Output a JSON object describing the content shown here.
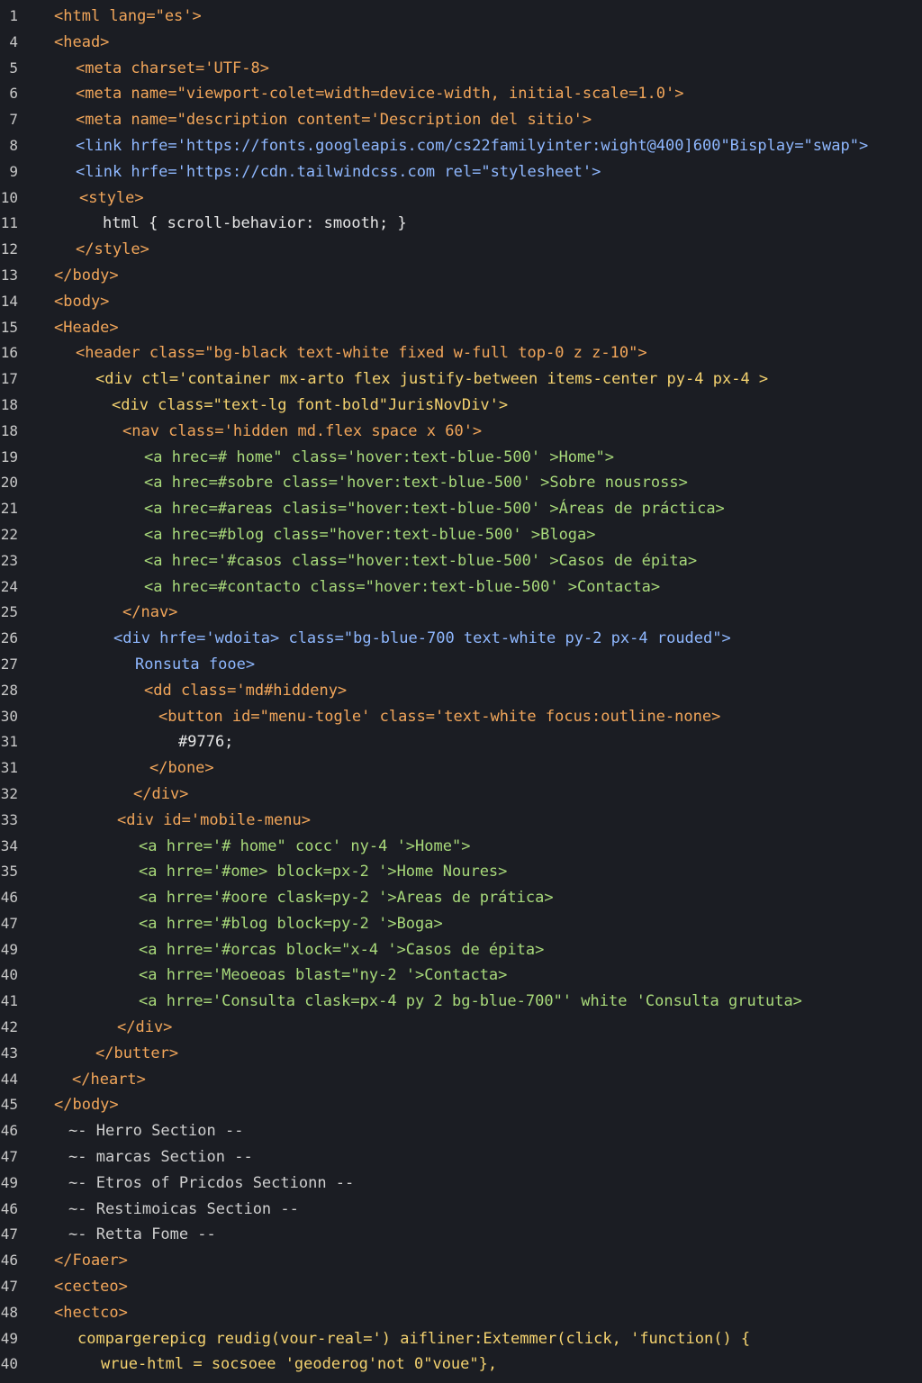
{
  "editor": {
    "lines": [
      {
        "number": "1",
        "indent": 0,
        "text": "<html lang=\"es'>",
        "color": "#f2a65a"
      },
      {
        "number": "4",
        "indent": 0,
        "text": "<head>",
        "color": "#f2a65a"
      },
      {
        "number": "5",
        "indent": 24,
        "text": "<meta charset='UTF-8>",
        "color": "#f2a65a"
      },
      {
        "number": "6",
        "indent": 24,
        "text": "<meta name=\"viewport-colet=width=device-width, initial-scale=1.0'>",
        "color": "#f2a65a"
      },
      {
        "number": "7",
        "indent": 24,
        "text": "<meta name=\"description content='Description del sitio'>",
        "color": "#f2a65a"
      },
      {
        "number": "8",
        "indent": 24,
        "text": "<link hrfe='https://fonts.googleapis.com/cs22familyinter:wight@400]600\"Bisplay=\"swap\">",
        "color": "#8fb8ff"
      },
      {
        "number": "9",
        "indent": 24,
        "text": "<link hrfe='https://cdn.tailwindcss.com rel=\"stylesheet'>",
        "color": "#8fb8ff"
      },
      {
        "number": "10",
        "indent": 28,
        "text": "<style>",
        "color": "#f2a65a"
      },
      {
        "number": "11",
        "indent": 54,
        "text": "html { scroll-behavior: smooth; }",
        "color": "#e6e6e6"
      },
      {
        "number": "12",
        "indent": 24,
        "text": "</style>",
        "color": "#f2a65a"
      },
      {
        "number": "13",
        "indent": 0,
        "text": "</body>",
        "color": "#f2a65a"
      },
      {
        "number": "14",
        "indent": 0,
        "text": "<body>",
        "color": "#f2a65a"
      },
      {
        "number": "15",
        "indent": 0,
        "text": "<Heade>",
        "color": "#f2a65a"
      },
      {
        "number": "16",
        "indent": 24,
        "text": "<header class=\"bg-black text-white fixed w-full top-0 z z-10\">",
        "color": "#f2a65a"
      },
      {
        "number": "17",
        "indent": 46,
        "text": "<div ctl='container mx-arto flex justify-between items-center py-4 px-4 >",
        "color": "#f4d26f"
      },
      {
        "number": "18",
        "indent": 64,
        "text": "<div class=\"text-lg font-bold\"JurisNovDiv'>",
        "color": "#f4d26f"
      },
      {
        "number": "18",
        "indent": 76,
        "text": "<nav class='hidden md.flex space x 60'>",
        "color": "#f2a65a"
      },
      {
        "number": "19",
        "indent": 100,
        "text": "<a hrec=# home\" class='hover:text-blue-500' >Home\">",
        "color": "#a8d97a"
      },
      {
        "number": "20",
        "indent": 100,
        "text": "<a hrec=#sobre class='hover:text-blue-500' >Sobre nousross>",
        "color": "#a8d97a"
      },
      {
        "number": "21",
        "indent": 100,
        "text": "<a hrec=#areas clasis=\"hover:text-blue-500' >Áreas de práctica>",
        "color": "#a8d97a"
      },
      {
        "number": "22",
        "indent": 100,
        "text": "<a hrec=#blog class=\"hover:text-blue-500' >Bloga>",
        "color": "#a8d97a"
      },
      {
        "number": "23",
        "indent": 100,
        "text": "<a hrec='#casos class=\"hover:text-blue-500' >Casos de épita>",
        "color": "#a8d97a"
      },
      {
        "number": "24",
        "indent": 100,
        "text": "<a hrec=#contacto class=\"hover:text-blue-500' >Contacta>",
        "color": "#a8d97a"
      },
      {
        "number": "25",
        "indent": 76,
        "text": "</nav>",
        "color": "#f2a65a"
      },
      {
        "number": "26",
        "indent": 66,
        "text": "<div hrfe='wdoita> class=\"bg-blue-700 text-white py-2 px-4 rouded\">",
        "color": "#8fb8ff"
      },
      {
        "number": "27",
        "indent": 90,
        "text": "Ronsuta fooe>",
        "color": "#8fb8ff"
      },
      {
        "number": "28",
        "indent": 100,
        "text": "<dd class='md#hiddeny>",
        "color": "#f2a65a"
      },
      {
        "number": "30",
        "indent": 116,
        "text": "<button id=\"menu-togle' class='text-white focus:outline-none>",
        "color": "#f2a65a"
      },
      {
        "number": "31",
        "indent": 138,
        "text": "#9776;",
        "color": "#e6e6e6"
      },
      {
        "number": "31",
        "indent": 106,
        "text": "</bone>",
        "color": "#f2a65a"
      },
      {
        "number": "32",
        "indent": 88,
        "text": "</div>",
        "color": "#f2a65a"
      },
      {
        "number": "33",
        "indent": 70,
        "text": "<div id='mobile-menu>",
        "color": "#f2a65a"
      },
      {
        "number": "34",
        "indent": 94,
        "text": "<a hrre='# home\" cocc' ny-4 '>Home\">",
        "color": "#a8d97a"
      },
      {
        "number": "35",
        "indent": 94,
        "text": "<a hrre='#ome> block=px-2 '>Home Noures>",
        "color": "#a8d97a"
      },
      {
        "number": "46",
        "indent": 94,
        "text": "<a hrre='#oore clask=py-2 '>Areas de prática>",
        "color": "#a8d97a"
      },
      {
        "number": "47",
        "indent": 94,
        "text": "<a hrre='#blog block=py-2 '>Boga>",
        "color": "#a8d97a"
      },
      {
        "number": "49",
        "indent": 94,
        "text": "<a hrre='#orcas block=\"x-4 '>Casos de épita>",
        "color": "#a8d97a"
      },
      {
        "number": "40",
        "indent": 94,
        "text": "<a hrre='Meoeoas blast=\"ny-2 '>Contacta>",
        "color": "#a8d97a"
      },
      {
        "number": "41",
        "indent": 94,
        "text": "<a hrre='Consulta clask=px-4 py 2 bg-blue-700\"' white 'Consulta grututa>",
        "color": "#a8d97a"
      },
      {
        "number": "42",
        "indent": 70,
        "text": "</div>",
        "color": "#f2a65a"
      },
      {
        "number": "43",
        "indent": 46,
        "text": "</butter>",
        "color": "#f2a65a"
      },
      {
        "number": "44",
        "indent": 20,
        "text": "</heart>",
        "color": "#f2a65a"
      },
      {
        "number": "45",
        "indent": 0,
        "text": "</body>",
        "color": "#f2a65a"
      },
      {
        "number": "46",
        "indent": 16,
        "text": "~- Herro Section --",
        "color": "#cfcfcf"
      },
      {
        "number": "47",
        "indent": 16,
        "text": "~- marcas Section --",
        "color": "#cfcfcf"
      },
      {
        "number": "49",
        "indent": 16,
        "text": "~- Etros of Pricdos Sectionn --",
        "color": "#cfcfcf"
      },
      {
        "number": "46",
        "indent": 16,
        "text": "~- Restimoicas Section --",
        "color": "#cfcfcf"
      },
      {
        "number": "47",
        "indent": 16,
        "text": "~- Retta Fome --",
        "color": "#cfcfcf"
      },
      {
        "number": "46",
        "indent": 0,
        "text": "</Foaer>",
        "color": "#f2a65a"
      },
      {
        "number": "47",
        "indent": 0,
        "text": "<cecteo>",
        "color": "#f2a65a"
      },
      {
        "number": "48",
        "indent": 0,
        "text": "<hectco>",
        "color": "#f2a65a"
      },
      {
        "number": "49",
        "indent": 26,
        "text": "compargerepicg reudig(vour-real=') aifliner:Extemmer(click, 'function() {",
        "color": "#f4d26f"
      },
      {
        "number": "40",
        "indent": 52,
        "text": "wrue-html = socsoee 'geoderog'not 0\"voue\"},",
        "color": "#f4d26f"
      }
    ]
  }
}
